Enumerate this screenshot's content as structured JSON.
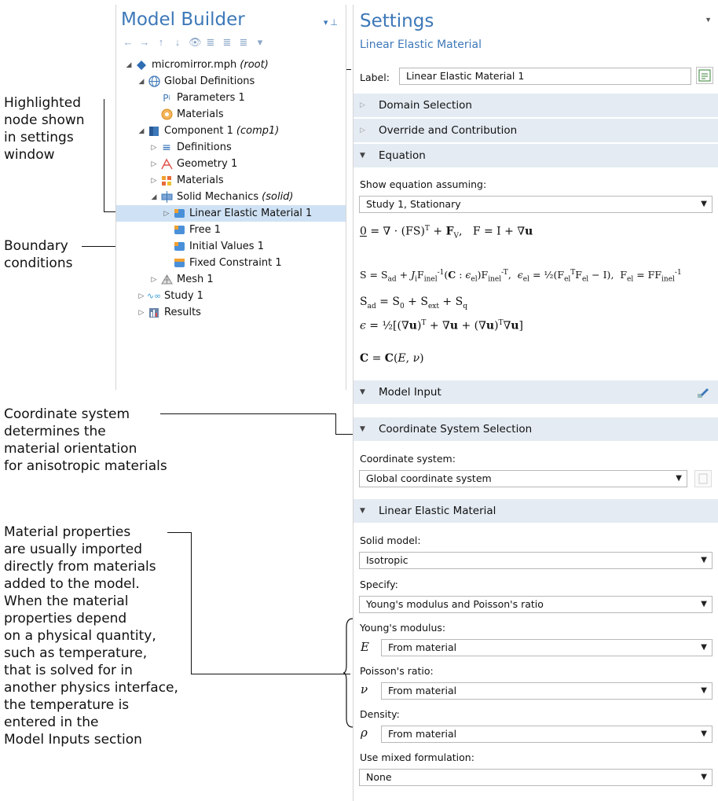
{
  "annotations": {
    "highlighted": "Highlighted\nnode shown\nin settings\nwindow",
    "boundary": "Boundary\nconditions",
    "coord": "Coordinate system\ndetermines the\nmaterial orientation\nfor anisotropic materials",
    "matprops": "Material properties\nare usually imported\ndirectly from materials\nadded to the model.\nWhen the material\nproperties depend\non a physical quantity,\nsuch as temperature,\nthat is solved for in\nanother physics interface,\nthe temperature is\nentered in the\nModel Inputs section"
  },
  "model_builder": {
    "title": "Model Builder",
    "toolbar": [
      "←",
      "→",
      "↑",
      "↓",
      "👁",
      "≣",
      "≣",
      "≣",
      "▾"
    ],
    "tree": [
      {
        "label": "micromirror.mph",
        "suffix": "(root)",
        "icon": "root-model-icon"
      },
      {
        "label": "Global Definitions",
        "icon": "globe-icon"
      },
      {
        "label": "Parameters 1",
        "icon": "parameters-icon"
      },
      {
        "label": "Materials",
        "icon": "materials-icon"
      },
      {
        "label": "Component 1",
        "suffix": "(comp1)",
        "icon": "component-icon"
      },
      {
        "label": "Definitions",
        "icon": "definitions-icon"
      },
      {
        "label": "Geometry 1",
        "icon": "geometry-icon"
      },
      {
        "label": "Materials",
        "icon": "materials-grid-icon"
      },
      {
        "label": "Solid Mechanics",
        "suffix": "(solid)",
        "icon": "solid-mechanics-icon"
      },
      {
        "label": "Linear Elastic Material 1",
        "icon": "linear-elastic-icon"
      },
      {
        "label": "Free 1",
        "icon": "free-icon"
      },
      {
        "label": "Initial Values 1",
        "icon": "initial-values-icon"
      },
      {
        "label": "Fixed Constraint 1",
        "icon": "fixed-constraint-icon"
      },
      {
        "label": "Mesh 1",
        "icon": "mesh-icon"
      },
      {
        "label": "Study 1",
        "icon": "study-icon"
      },
      {
        "label": "Results",
        "icon": "results-icon"
      }
    ]
  },
  "settings": {
    "title": "Settings",
    "subtitle": "Linear Elastic Material",
    "label_caption": "Label:",
    "label_value": "Linear Elastic Material 1",
    "sections": {
      "domain": "Domain Selection",
      "override": "Override and Contribution",
      "equation": "Equation",
      "model_input": "Model Input",
      "coord_sel": "Coordinate System Selection",
      "lem": "Linear Elastic Material"
    },
    "show_eq_label": "Show equation assuming:",
    "show_eq_value": "Study 1, Stationary",
    "coord_label": "Coordinate system:",
    "coord_value": "Global coordinate system",
    "solid_model_label": "Solid model:",
    "solid_model_value": "Isotropic",
    "specify_label": "Specify:",
    "specify_value": "Young's modulus and Poisson's ratio",
    "youngs_label": "Young's modulus:",
    "youngs_symbol": "E",
    "youngs_value": "From material",
    "poisson_label": "Poisson's ratio:",
    "poisson_symbol": "ν",
    "poisson_value": "From material",
    "density_label": "Density:",
    "density_symbol": "ρ",
    "density_value": "From material",
    "mixed_label": "Use mixed formulation:",
    "mixed_value": "None"
  },
  "colors": {
    "accent": "#3d78b8",
    "section_bg": "#e4ebf3",
    "selection": "#cfe2f5"
  }
}
